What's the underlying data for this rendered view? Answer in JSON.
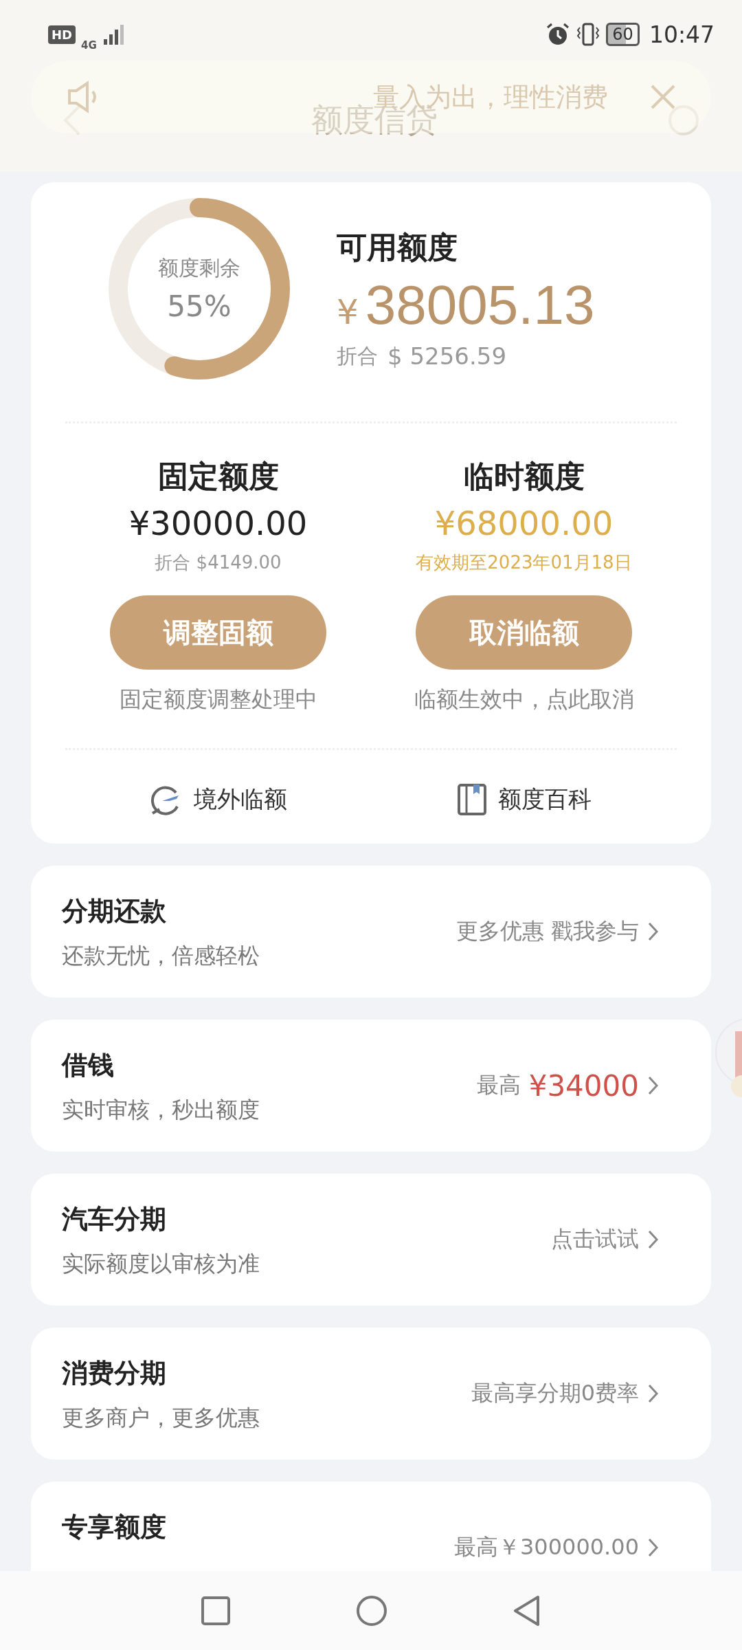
{
  "status_bar": {
    "hd": "HD",
    "network": "4G",
    "battery": "60",
    "time": "10:47"
  },
  "banner": {
    "text": "量入为出，理性消费"
  },
  "header": {
    "title": "额度信贷"
  },
  "summary": {
    "ring_label": "额度剩余",
    "ring_value": "55%",
    "level": 0.55,
    "title": "可用额度",
    "currency": "¥",
    "amount": "38005.13",
    "converted_label": "折合",
    "converted_value": "$ 5256.59"
  },
  "limits": [
    {
      "title": "固定额度",
      "amount": "¥30000.00",
      "accent": false,
      "note": "折合 $4149.00",
      "button": "调整固额",
      "status": "固定额度调整处理中"
    },
    {
      "title": "临时额度",
      "amount": "¥68000.00",
      "accent": true,
      "note": "有效期至2023年01月18日",
      "button": "取消临额",
      "status": "临额生效中，点此取消"
    }
  ],
  "links": [
    {
      "kind": "plane",
      "label": "境外临额"
    },
    {
      "kind": "book",
      "label": "额度百科"
    }
  ],
  "services": [
    {
      "title": "分期还款",
      "subtitle": "还款无忧，倍感轻松",
      "right": [
        {
          "text": "更多优惠 戳我参与",
          "highlight": false
        }
      ]
    },
    {
      "title": "借钱",
      "subtitle": "实时审核，秒出额度",
      "right": [
        {
          "text": "最高",
          "highlight": false
        },
        {
          "text": "¥34000",
          "highlight": true
        }
      ]
    },
    {
      "title": "汽车分期",
      "subtitle": "实际额度以审核为准",
      "right": [
        {
          "text": "点击试试",
          "highlight": false
        }
      ]
    },
    {
      "title": "消费分期",
      "subtitle": "更多商户，更多优惠",
      "right": [
        {
          "text": "最高享分期0费率",
          "highlight": false
        }
      ]
    },
    {
      "title": "专享额度",
      "right": [
        {
          "text": "最高￥300000.00",
          "highlight": false
        }
      ]
    }
  ]
}
